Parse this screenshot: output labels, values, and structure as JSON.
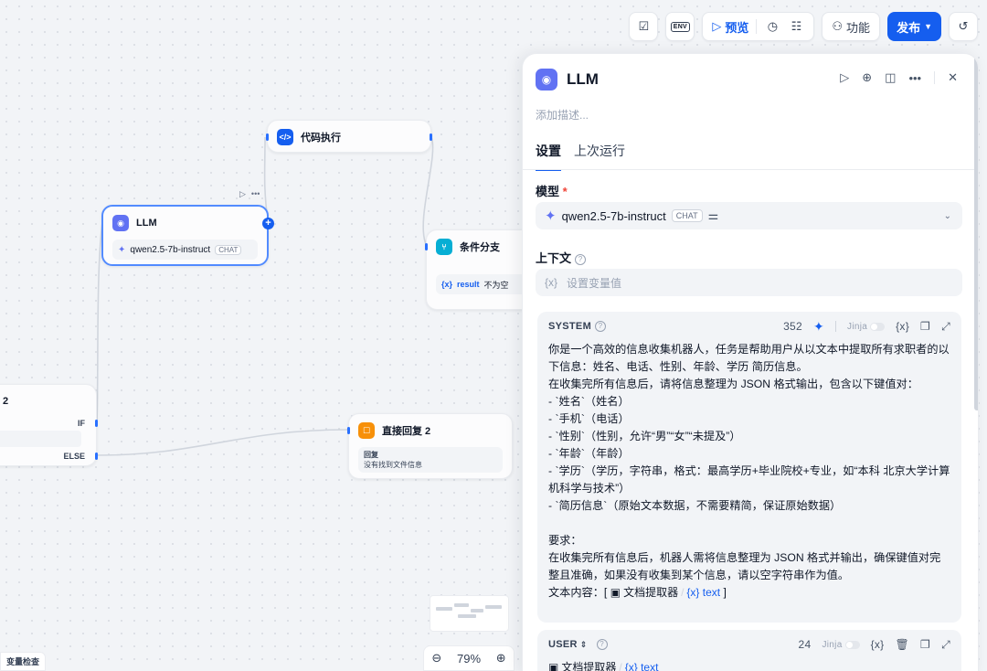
{
  "toolbar": {
    "env_label": "ENV",
    "preview_label": "预览",
    "features_label": "功能",
    "publish_label": "发布"
  },
  "nodes": {
    "code": {
      "title": "代码执行"
    },
    "llm": {
      "title": "LLM",
      "model": "qwen2.5-7b-instruct",
      "model_tag": "CHAT"
    },
    "ifelse": {
      "title": "条件分支",
      "cond_var": "result",
      "cond_op": "不为空"
    },
    "ifelse_left": {
      "title_suffix": "2",
      "if_label": "IF",
      "else_label": "ELSE"
    },
    "reply": {
      "title": "直接回复 2",
      "reply_label": "回复",
      "reply_text": "没有找到文件信息"
    }
  },
  "bottom": {
    "var_check": "变量检查",
    "zoom_level": "79%"
  },
  "panel": {
    "title": "LLM",
    "description_placeholder": "添加描述...",
    "tabs": [
      "设置",
      "上次运行"
    ],
    "model_label": "模型",
    "model_name": "qwen2.5-7b-instruct",
    "model_tag": "CHAT",
    "context_label": "上下文",
    "context_placeholder": "设置变量值",
    "context_var_icon": "{x}",
    "system": {
      "label": "SYSTEM",
      "count": "352",
      "jinja": "Jinja",
      "body": "你是一个高效的信息收集机器人，任务是帮助用户从以文本中提取所有求职者的以下信息：姓名、电话、性别、年龄、学历 简历信息。\n在收集完所有信息后，请将信息整理为 JSON 格式输出，包含以下键值对：\n- `姓名`（姓名）\n- `手机`（电话）\n- `性别`（性别，允许“男”“女”“未提及”）\n- `年龄`（年龄）\n- `学历`（学历，字符串，格式：最高学历+毕业院校+专业，如“本科 北京大学计算机科学与技术”）\n- `简历信息`（原始文本数据，不需要精简，保证原始数据）\n\n要求：\n在收集完所有信息后，机器人需将信息整理为 JSON 格式并输出，确保键值对完整且准确，如果没有收集到某个信息，请以空字符串作为值。\n",
      "ref_prefix": "文本内容：[",
      "ref_node": "文档提取器",
      "ref_var": "text",
      "ref_suffix": "]"
    },
    "user": {
      "label": "USER",
      "count": "24",
      "jinja": "Jinja",
      "ref_node": "文档提取器",
      "ref_var": "text"
    }
  }
}
